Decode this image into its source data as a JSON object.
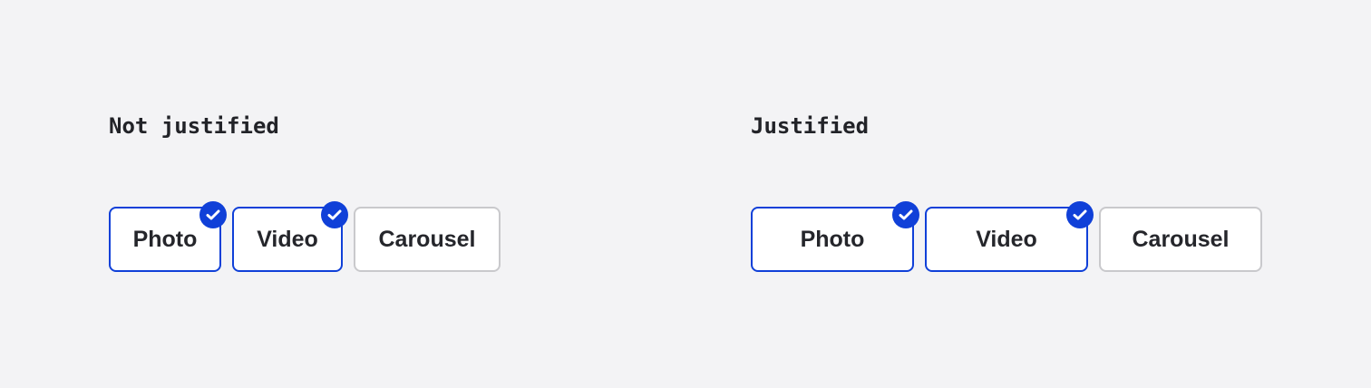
{
  "sections": [
    {
      "title": "Not justified",
      "chips": [
        {
          "label": "Photo",
          "selected": true
        },
        {
          "label": "Video",
          "selected": true
        },
        {
          "label": "Carousel",
          "selected": false
        }
      ]
    },
    {
      "title": "Justified",
      "chips": [
        {
          "label": "Photo",
          "selected": true
        },
        {
          "label": "Video",
          "selected": true
        },
        {
          "label": "Carousel",
          "selected": false
        }
      ]
    }
  ],
  "colors": {
    "background": "#f3f3f5",
    "selected_border": "#1040d8",
    "unselected_border": "#c9c9cc",
    "text": "#25262b"
  },
  "icons": {
    "selected_indicator": "check-icon"
  }
}
